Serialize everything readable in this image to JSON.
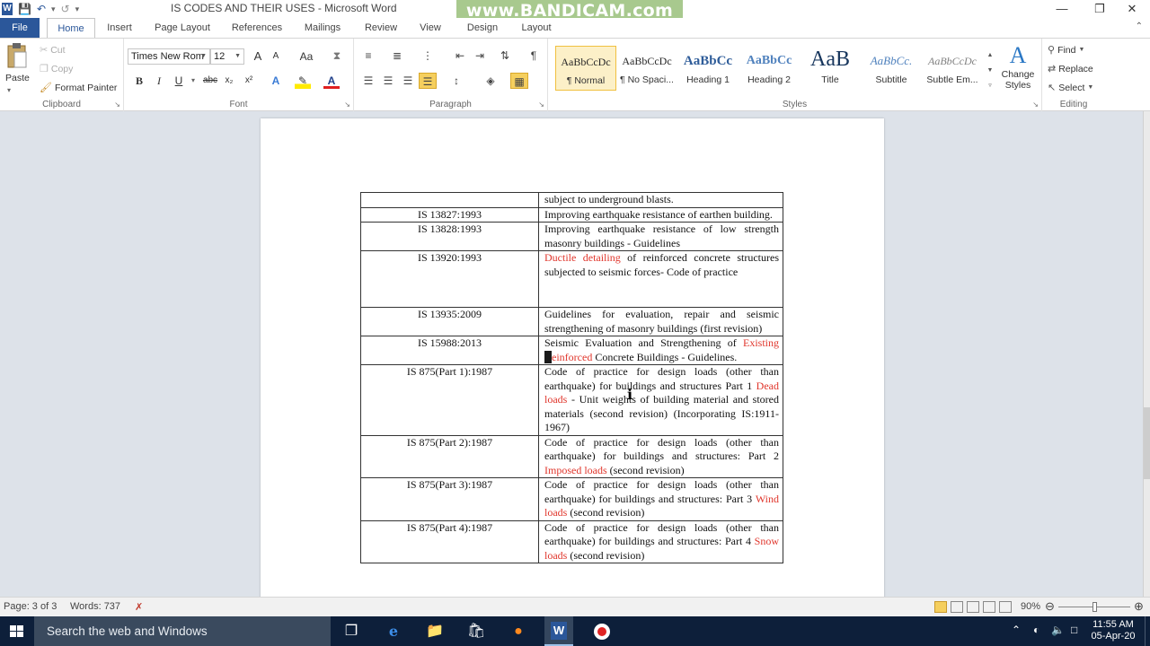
{
  "title_bar": {
    "document_title": "IS CODES AND THEIR USES - Microsoft Word",
    "watermark": "www.BANDICAM.com",
    "logo_letter": "W"
  },
  "tabs": [
    "File",
    "Home",
    "Insert",
    "Page Layout",
    "References",
    "Mailings",
    "Review",
    "View",
    "Design",
    "Layout"
  ],
  "ribbon": {
    "clipboard": {
      "label": "Clipboard",
      "paste": "Paste",
      "cut": "Cut",
      "copy": "Copy",
      "format_painter": "Format Painter"
    },
    "font": {
      "label": "Font",
      "font_name": "Times New Rom",
      "font_size": "12",
      "bold": "B",
      "italic": "I",
      "underline": "U",
      "strike": "abc",
      "subscript": "x₂",
      "superscript": "x²",
      "case": "Aa",
      "grow": "A",
      "shrink": "A"
    },
    "paragraph": {
      "label": "Paragraph"
    },
    "styles": {
      "label": "Styles",
      "items": [
        {
          "preview": "AaBbCcDc",
          "name": "¶ Normal"
        },
        {
          "preview": "AaBbCcDc",
          "name": "¶ No Spaci..."
        },
        {
          "preview": "AaBbCc",
          "name": "Heading 1"
        },
        {
          "preview": "AaBbCc",
          "name": "Heading 2"
        },
        {
          "preview": "AaB",
          "name": "Title"
        },
        {
          "preview": "AaBbCc.",
          "name": "Subtitle"
        },
        {
          "preview": "AaBbCcDc",
          "name": "Subtle Em..."
        }
      ],
      "change_styles": "Change Styles"
    },
    "editing": {
      "label": "Editing",
      "find": "Find",
      "replace": "Replace",
      "select": "Select"
    }
  },
  "document": {
    "rows": [
      {
        "code": "",
        "desc": "subject to underground blasts."
      },
      {
        "code": "IS 13827:1993",
        "desc": "Improving earthquake resistance of earthen building."
      },
      {
        "code": "IS 13828:1993",
        "desc": "Improving earthquake resistance of low strength masonry buildings - Guidelines"
      },
      {
        "code": "IS 13920:1993",
        "desc_red": "Ductile detailing",
        "desc_rest": " of reinforced concrete structures subjected to seismic forces- Code of practice"
      },
      {
        "code": "IS 13935:2009",
        "desc": "Guidelines for evaluation, repair and seismic strengthening of masonry buildings (first revision)"
      },
      {
        "code": "IS 15988:2013",
        "desc_pre": "Seismic Evaluation and Strengthening of ",
        "desc_red": "Existing ",
        "desc_cursor": "R",
        "desc_red2": "einforced",
        "desc_rest": " Concrete Buildings - Guidelines."
      },
      {
        "code": "IS 875(Part 1):1987",
        "desc_pre": "Code of practice for design loads (other than earthquake) for buildings and structures Part 1 ",
        "desc_red": "Dead loads",
        "desc_rest": " - Unit weights of building material and stored materials (second revision) (Incorporating IS:1911-1967)"
      },
      {
        "code": "IS 875(Part 2):1987",
        "desc_pre": "Code of practice for design loads (other than earthquake) for buildings and structures: Part 2 ",
        "desc_red": "Imposed loads",
        "desc_rest": " (second revision)"
      },
      {
        "code": "IS 875(Part 3):1987",
        "desc_pre": "Code of practice for design loads (other than earthquake) for buildings and structures: Part 3 ",
        "desc_red": "Wind loads",
        "desc_rest": " (second revision)"
      },
      {
        "code": "IS 875(Part 4):1987",
        "desc_pre": "Code of practice for design loads (other than earthquake) for buildings and structures: Part 4 ",
        "desc_red": "Snow loads",
        "desc_rest": " (second revision)"
      }
    ]
  },
  "status_bar": {
    "page": "Page: 3 of 3",
    "words": "Words: 737",
    "zoom": "90%"
  },
  "taskbar": {
    "search_placeholder": "Search the web and Windows",
    "time": "11:55 AM",
    "date": "05-Apr-20"
  },
  "colors": {
    "word_blue": "#2b579a",
    "spell_red": "#e0352b",
    "taskbar": "#0d1f3a",
    "selected_style": "#fcf0c8"
  }
}
